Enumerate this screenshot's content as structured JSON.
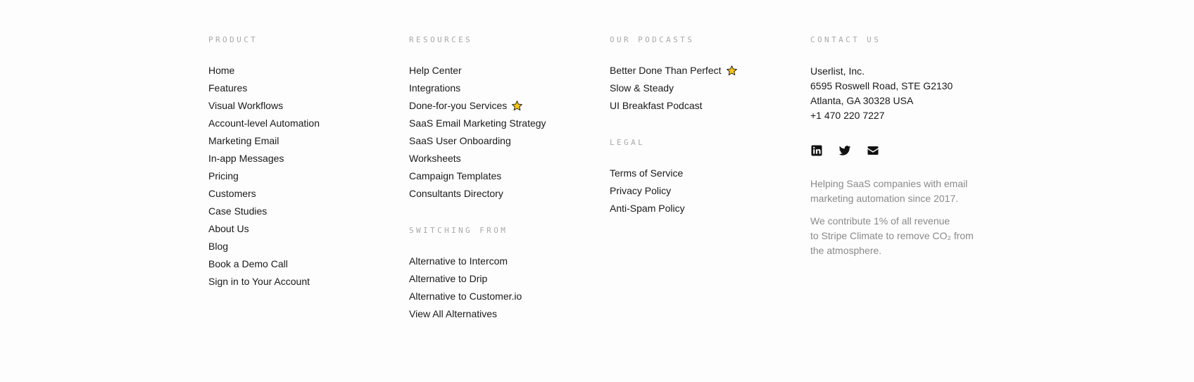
{
  "product": {
    "heading": "PRODUCT",
    "items": [
      "Home",
      "Features",
      "Visual Workflows",
      "Account-level Automation",
      "Marketing Email",
      "In-app Messages",
      "Pricing",
      "Customers",
      "Case Studies",
      "About Us",
      "Blog",
      "Book a Demo Call",
      "Sign in to Your Account"
    ]
  },
  "resources": {
    "heading": "RESOURCES",
    "items": [
      "Help Center",
      "Integrations",
      "Done-for-you Services",
      "SaaS Email Marketing Strategy",
      "SaaS User Onboarding",
      "Worksheets",
      "Campaign Templates",
      "Consultants Directory"
    ],
    "starred_item": "Done-for-you Services"
  },
  "switching": {
    "heading": "SWITCHING FROM",
    "items": [
      "Alternative to Intercom",
      "Alternative to Drip",
      "Alternative to Customer.io",
      "View All Alternatives"
    ]
  },
  "podcasts": {
    "heading": "OUR PODCASTS",
    "items": [
      "Better Done Than Perfect",
      "Slow & Steady",
      "UI Breakfast Podcast"
    ],
    "starred_item": "Better Done Than Perfect"
  },
  "legal": {
    "heading": "LEGAL",
    "items": [
      "Terms of Service",
      "Privacy Policy",
      "Anti-Spam Policy"
    ]
  },
  "contact": {
    "heading": "CONTACT US",
    "address": [
      "Userlist, Inc.",
      "6595 Roswell Road, STE G2130",
      "Atlanta, GA 30328 USA",
      "+1 470 220 7227"
    ],
    "social": [
      "linkedin-icon",
      "twitter-icon",
      "email-icon"
    ],
    "blurb1": [
      "Helping SaaS companies with email",
      "marketing automation since 2017."
    ],
    "blurb2": [
      "We contribute 1% of all revenue",
      "to Stripe Climate to remove CO₂ from",
      "the atmosphere."
    ]
  },
  "colors": {
    "heading": "#a9a9a9",
    "link": "#1a1a1a",
    "muted": "#8a8a8a",
    "star": "#f5c518",
    "background": "#fdfdfd"
  }
}
